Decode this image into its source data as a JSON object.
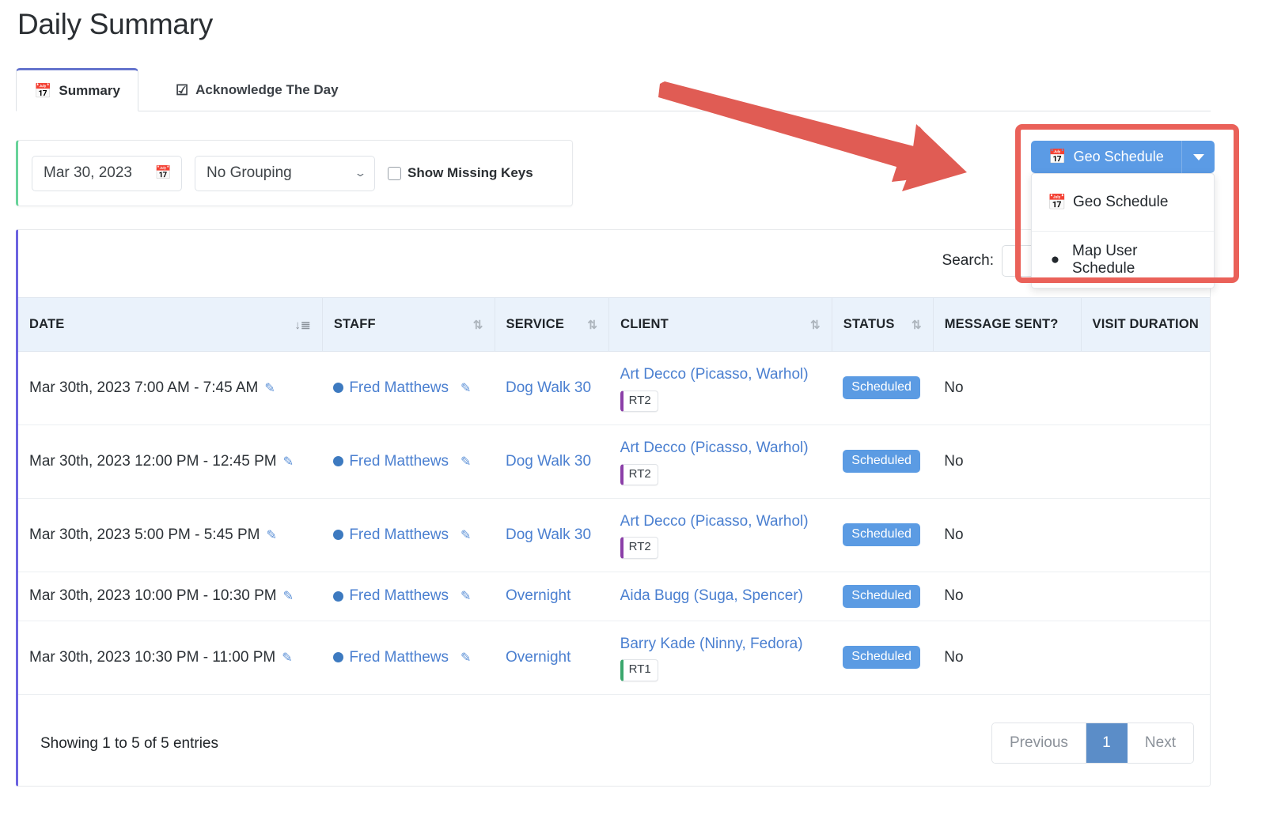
{
  "page": {
    "title": "Daily Summary"
  },
  "tabs": [
    {
      "label": "Summary",
      "icon": "calendar-icon",
      "glyph": "Ὕ3",
      "active": true
    },
    {
      "label": "Acknowledge The Day",
      "icon": "check-square-icon",
      "glyph": "☑",
      "active": false
    }
  ],
  "filters": {
    "date": {
      "value": "Mar 30, 2023",
      "icon": "calendar-icon"
    },
    "grouping": {
      "value": "No Grouping",
      "icon": "chevron-down-icon"
    },
    "missing_keys": {
      "label": "Show Missing Keys",
      "checked": false
    }
  },
  "action_button": {
    "label": "Geo Schedule",
    "icon": "calendar-icon",
    "toggle_icon": "caret-down-icon",
    "color": "#5b9be5",
    "menu": [
      {
        "label": "Geo Schedule",
        "icon": "calendar-icon",
        "glyph": "Ὕ3"
      },
      {
        "label": "Map User Schedule",
        "icon": "map-pin-icon",
        "glyph": "ὌD"
      }
    ]
  },
  "search": {
    "label": "Search:",
    "value": "",
    "placeholder": ""
  },
  "table": {
    "columns": [
      {
        "label": "DATE",
        "sort": "desc",
        "sortable": true
      },
      {
        "label": "STAFF",
        "sort": "none",
        "sortable": true
      },
      {
        "label": "SERVICE",
        "sort": "none",
        "sortable": true
      },
      {
        "label": "CLIENT",
        "sort": "none",
        "sortable": true
      },
      {
        "label": "STATUS",
        "sort": "none",
        "sortable": true
      },
      {
        "label": "MESSAGE SENT?",
        "sort": null,
        "sortable": false
      },
      {
        "label": "VISIT DURATION",
        "sort": null,
        "sortable": false
      }
    ],
    "rows": [
      {
        "date": "Mar 30th, 2023 7:00 AM - 7:45 AM",
        "staff": "Fred Matthews",
        "service": "Dog Walk 30",
        "client": "Art Decco (Picasso, Warhol)",
        "client_badge": "RT2",
        "client_badge_color": "purple",
        "status": "Scheduled",
        "message_sent": "No",
        "visit_duration": ""
      },
      {
        "date": "Mar 30th, 2023 12:00 PM - 12:45 PM",
        "staff": "Fred Matthews",
        "service": "Dog Walk 30",
        "client": "Art Decco (Picasso, Warhol)",
        "client_badge": "RT2",
        "client_badge_color": "purple",
        "status": "Scheduled",
        "message_sent": "No",
        "visit_duration": ""
      },
      {
        "date": "Mar 30th, 2023 5:00 PM - 5:45 PM",
        "staff": "Fred Matthews",
        "service": "Dog Walk 30",
        "client": "Art Decco (Picasso, Warhol)",
        "client_badge": "RT2",
        "client_badge_color": "purple",
        "status": "Scheduled",
        "message_sent": "No",
        "visit_duration": ""
      },
      {
        "date": "Mar 30th, 2023 10:00 PM - 10:30 PM",
        "staff": "Fred Matthews",
        "service": "Overnight",
        "client": "Aida Bugg (Suga, Spencer)",
        "client_badge": "",
        "client_badge_color": "",
        "status": "Scheduled",
        "message_sent": "No",
        "visit_duration": ""
      },
      {
        "date": "Mar 30th, 2023 10:30 PM - 11:00 PM",
        "staff": "Fred Matthews",
        "service": "Overnight",
        "client": "Barry Kade (Ninny, Fedora)",
        "client_badge": "RT1",
        "client_badge_color": "green",
        "status": "Scheduled",
        "message_sent": "No",
        "visit_duration": ""
      }
    ],
    "info": "Showing 1 to 5 of 5 entries",
    "pagination": {
      "previous": "Previous",
      "pages": [
        "1"
      ],
      "current": "1",
      "next": "Next"
    }
  },
  "annotations": {
    "highlight_color": "#ea6159",
    "arrow_color": "#e05c54"
  }
}
